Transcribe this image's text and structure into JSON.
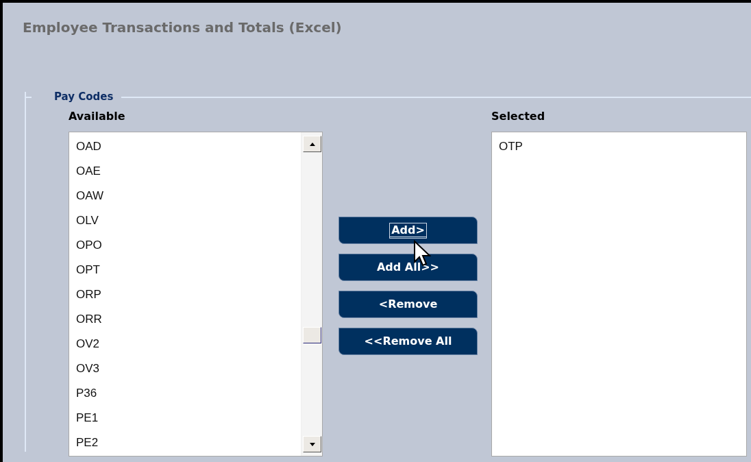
{
  "title": "Employee Transactions and Totals (Excel)",
  "pay_codes": {
    "legend": "Pay Codes",
    "available": {
      "label": "Available",
      "items": [
        "OAD",
        "OAE",
        "OAW",
        "OLV",
        "OPO",
        "OPT",
        "ORP",
        "ORR",
        "OV2",
        "OV3",
        "P36",
        "PE1",
        "PE2"
      ]
    },
    "buttons": [
      {
        "label": "Add>",
        "focused": true
      },
      {
        "label": "Add All>>",
        "focused": false
      },
      {
        "label": "<Remove",
        "focused": false
      },
      {
        "label": "<<Remove All",
        "focused": false
      }
    ],
    "selected": {
      "label": "Selected",
      "items": [
        "OTP"
      ]
    }
  }
}
